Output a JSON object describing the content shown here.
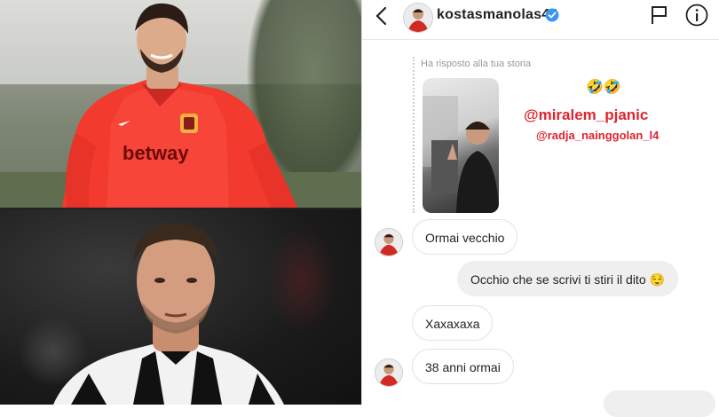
{
  "conversation": {
    "username": "kostasmanolas44",
    "story_reply_label": "Ha risposto alla tua storia",
    "story": {
      "emoji": "🤣🤣",
      "tag_primary": "@miralem_pjanic",
      "tag_secondary": "@radja_nainggolan_l4"
    },
    "messages": [
      {
        "direction": "in",
        "text": "Ormai vecchio"
      },
      {
        "direction": "out",
        "text": "Occhio che se scrivi ti stiri il dito 😌"
      },
      {
        "direction": "in",
        "text": "Xaxaxaxa"
      },
      {
        "direction": "in",
        "text": "38 anni ormai"
      }
    ]
  },
  "photos": {
    "top_shirt_text": "betway"
  },
  "colors": {
    "tag_red": "#e0242f",
    "verified_blue": "#3897f0",
    "roma_red": "#f23a2e",
    "juve_black": "#111111"
  }
}
